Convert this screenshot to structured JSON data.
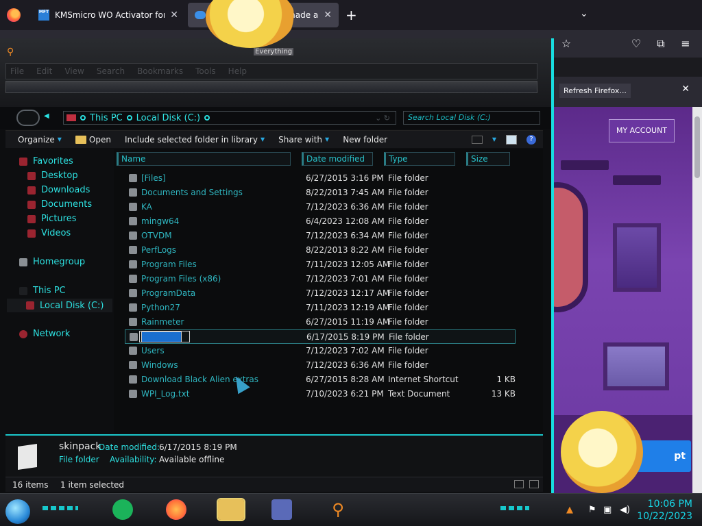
{
  "browser": {
    "tabs": [
      {
        "favicon": "MFT",
        "title": "KMSmicro WO Activator for offi",
        "active": false
      },
      {
        "title": "e made a",
        "active": true
      }
    ],
    "notification_button": "Refresh Firefox...",
    "icons": [
      "firefox-logo-icon",
      "close-icon",
      "new-tab-icon",
      "list-all-tabs-icon",
      "star-icon",
      "pocket-icon",
      "extensions-icon",
      "menu-icon"
    ]
  },
  "web": {
    "account_button": "MY ACCOUNT",
    "accept_button": "pt"
  },
  "explorer": {
    "everything_label": "Everything",
    "menu": [
      "File",
      "Edit",
      "View",
      "Search",
      "Bookmarks",
      "Tools",
      "Help"
    ],
    "breadcrumb": [
      "This PC",
      "Local Disk (C:)"
    ],
    "search_placeholder": "Search Local Disk (C:)",
    "toolbar": {
      "organize": "Organize",
      "open": "Open",
      "include": "Include selected folder in library",
      "share": "Share with",
      "new_folder": "New folder"
    },
    "nav": {
      "favorites": "Favorites",
      "desktop": "Desktop",
      "downloads": "Downloads",
      "documents": "Documents",
      "pictures": "Pictures",
      "videos": "Videos",
      "homegroup": "Homegroup",
      "this_pc": "This PC",
      "local_disk": "Local Disk (C:)",
      "network": "Network"
    },
    "columns": {
      "name": "Name",
      "date": "Date modified",
      "type": "Type",
      "size": "Size"
    },
    "files": [
      {
        "name": "[Files]",
        "date": "6/27/2015 3:16 PM",
        "type": "File folder",
        "size": ""
      },
      {
        "name": "Documents and Settings",
        "date": "8/22/2013 7:45 AM",
        "type": "File folder",
        "size": ""
      },
      {
        "name": "KA",
        "date": "7/12/2023 6:36 AM",
        "type": "File folder",
        "size": ""
      },
      {
        "name": "mingw64",
        "date": "6/4/2023 12:08 AM",
        "type": "File folder",
        "size": ""
      },
      {
        "name": "OTVDM",
        "date": "7/12/2023 6:34 AM",
        "type": "File folder",
        "size": ""
      },
      {
        "name": "PerfLogs",
        "date": "8/22/2013 8:22 AM",
        "type": "File folder",
        "size": ""
      },
      {
        "name": "Program Files",
        "date": "7/11/2023 12:05 AM",
        "type": "File folder",
        "size": ""
      },
      {
        "name": "Program Files (x86)",
        "date": "7/12/2023 7:01 AM",
        "type": "File folder",
        "size": ""
      },
      {
        "name": "ProgramData",
        "date": "7/12/2023 12:17 AM",
        "type": "File folder",
        "size": ""
      },
      {
        "name": "Python27",
        "date": "7/11/2023 12:19 AM",
        "type": "File folder",
        "size": ""
      },
      {
        "name": "Rainmeter",
        "date": "6/27/2015 11:19 AM",
        "type": "File folder",
        "size": ""
      },
      {
        "name": "skinpack",
        "date": "6/17/2015 8:19 PM",
        "type": "File folder",
        "size": "",
        "selected": true
      },
      {
        "name": "Users",
        "date": "7/12/2023 7:02 AM",
        "type": "File folder",
        "size": ""
      },
      {
        "name": "Windows",
        "date": "7/12/2023 6:36 AM",
        "type": "File folder",
        "size": ""
      },
      {
        "name": "Download Black Alien extras",
        "date": "6/27/2015 8:28 AM",
        "type": "Internet Shortcut",
        "size": "1 KB"
      },
      {
        "name": "WPI_Log.txt",
        "date": "7/10/2023 6:21 PM",
        "type": "Text Document",
        "size": "13 KB"
      }
    ],
    "details": {
      "name": "skinpack",
      "kind": "File folder",
      "date_label": "Date modified:",
      "date_value": "6/17/2015 8:19 PM",
      "avail_label": "Availability:",
      "avail_value": "Available offline"
    },
    "status": {
      "count": "16 items",
      "selected": "1 item selected"
    }
  },
  "taskbar": {
    "time": "10:06 PM",
    "date": "10/22/2023"
  }
}
